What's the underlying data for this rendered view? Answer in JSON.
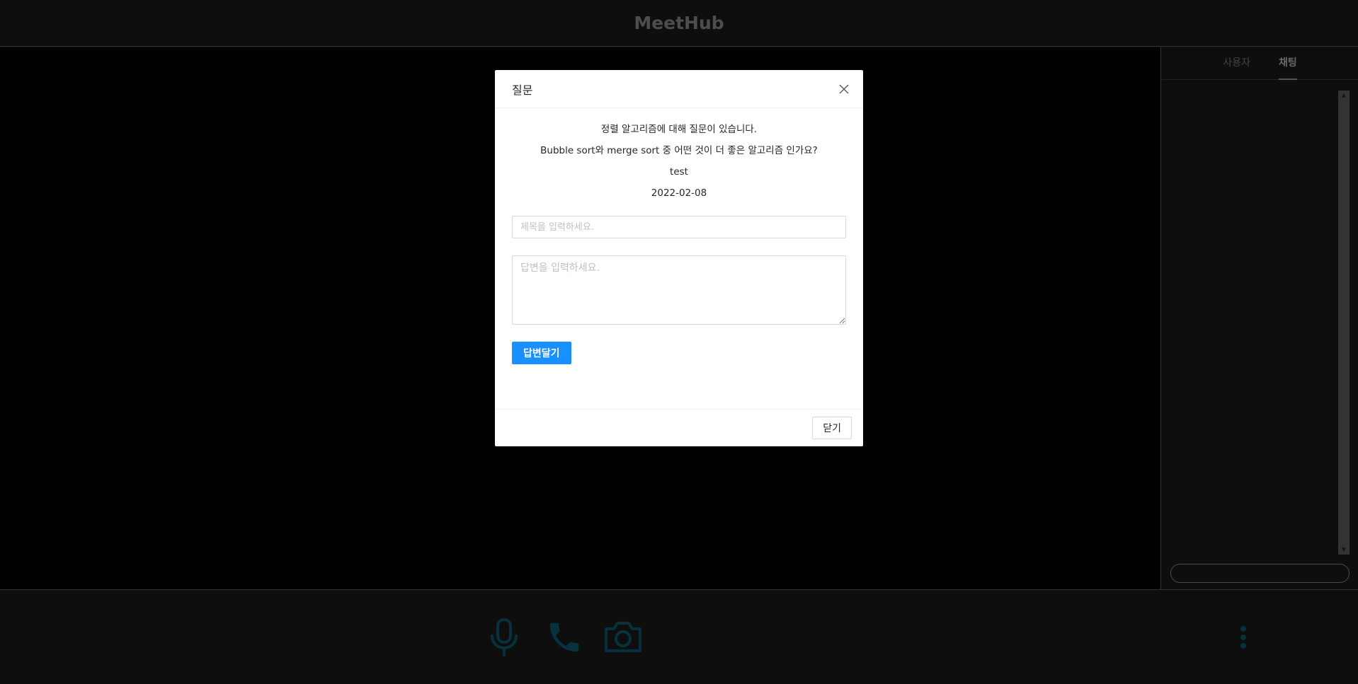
{
  "app": {
    "title": "MeetHub"
  },
  "side_panel": {
    "tabs": [
      {
        "label": "사용자",
        "active": false
      },
      {
        "label": "채팅",
        "active": true
      }
    ],
    "chat_input": {
      "value": "",
      "placeholder": ""
    }
  },
  "controls": {
    "icons": [
      "mic-icon",
      "phone-icon",
      "camera-icon",
      "more-vertical-icon"
    ],
    "accent_color": "#0e5a6e"
  },
  "modal": {
    "title": "질문",
    "question": {
      "title": "정렬 알고리즘에 대해 질문이 있습니다.",
      "content": "Bubble sort와 merge sort 중 어떤 것이 더 좋은 알고리즘 인가요?",
      "author": "test",
      "date": "2022-02-08"
    },
    "answer_title_placeholder": "제목을 입력하세요.",
    "answer_body_placeholder": "답변을 입력하세요.",
    "submit_label": "답변달기",
    "close_label": "닫기",
    "primary_color": "#1890ff"
  }
}
